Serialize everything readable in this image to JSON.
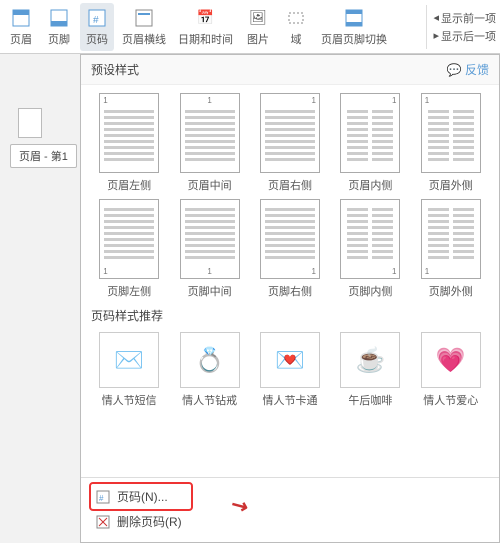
{
  "ribbon": {
    "items": [
      {
        "label": "页眉",
        "icon": "▭"
      },
      {
        "label": "页脚",
        "icon": "▭"
      },
      {
        "label": "页码",
        "icon": "#"
      },
      {
        "label": "页眉横线",
        "icon": "―"
      },
      {
        "label": "日期和时间",
        "icon": "📅"
      },
      {
        "label": "图片",
        "icon": "🖼"
      },
      {
        "label": "域",
        "icon": "{}"
      },
      {
        "label": "页眉页脚切换",
        "icon": "⇄"
      }
    ],
    "right_items": [
      {
        "label": "显示前一项"
      },
      {
        "label": "显示后一项"
      }
    ]
  },
  "breadcrumb": {
    "label": "页眉 - 第1"
  },
  "dropdown": {
    "preset_styles_title": "预设样式",
    "feedback_label": "反馈",
    "styles": [
      {
        "label": "页眉左侧",
        "num_pos": "top-left",
        "two_col": false
      },
      {
        "label": "页眉中间",
        "num_pos": "top-center",
        "two_col": false
      },
      {
        "label": "页眉右侧",
        "num_pos": "top-right",
        "two_col": false
      },
      {
        "label": "页眉内侧",
        "num_pos": "top-right",
        "two_col": true
      },
      {
        "label": "页眉外侧",
        "num_pos": "top-left",
        "two_col": true
      },
      {
        "label": "页脚左侧",
        "num_pos": "bot-left",
        "two_col": false
      },
      {
        "label": "页脚中间",
        "num_pos": "bot-center",
        "two_col": false
      },
      {
        "label": "页脚右侧",
        "num_pos": "bot-right",
        "two_col": false
      },
      {
        "label": "页脚内侧",
        "num_pos": "bot-right",
        "two_col": true
      },
      {
        "label": "页脚外侧",
        "num_pos": "bot-left",
        "two_col": true
      }
    ],
    "recommended_title": "页码样式推荐",
    "recommended": [
      {
        "label": "情人节短信",
        "emoji": "✉️"
      },
      {
        "label": "情人节钻戒",
        "emoji": "💍"
      },
      {
        "label": "情人节卡通",
        "emoji": "💌"
      },
      {
        "label": "午后咖啡",
        "emoji": "☕"
      },
      {
        "label": "情人节爱心",
        "emoji": "💗"
      }
    ],
    "menu_page_number": "页码(N)...",
    "menu_delete_page_number": "删除页码(R)"
  }
}
